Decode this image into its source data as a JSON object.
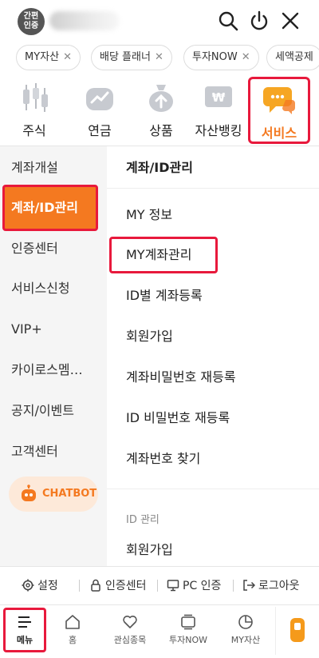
{
  "header": {
    "auth_badge": "간편\n인증",
    "icons": [
      "search-icon",
      "power-icon",
      "close-icon"
    ]
  },
  "chips": [
    {
      "label": "MY자산"
    },
    {
      "label": "배당 플래너"
    },
    {
      "label": "투자NOW"
    },
    {
      "label": "세액공제"
    }
  ],
  "categories": [
    {
      "label": "주식",
      "icon": "candlestick-icon"
    },
    {
      "label": "연금",
      "icon": "piggy-bank-icon"
    },
    {
      "label": "상품",
      "icon": "money-bag-icon"
    },
    {
      "label": "자산뱅킹",
      "icon": "won-card-icon"
    },
    {
      "label": "서비스",
      "icon": "chat-bubble-icon",
      "active": true
    }
  ],
  "sidebar": {
    "items": [
      {
        "label": "계좌개설"
      },
      {
        "label": "계좌/ID관리",
        "active": true
      },
      {
        "label": "인증센터"
      },
      {
        "label": "서비스신청"
      },
      {
        "label": "VIP+"
      },
      {
        "label": "카이로스멤…"
      },
      {
        "label": "공지/이벤트"
      },
      {
        "label": "고객센터"
      }
    ],
    "chatbot_label": "CHATBOT"
  },
  "main": {
    "heading": "계좌/ID관리",
    "items": [
      {
        "label": "MY 정보"
      },
      {
        "label": "MY계좌관리",
        "highlighted": true
      },
      {
        "label": "ID별 계좌등록"
      },
      {
        "label": "회원가입"
      },
      {
        "label": "계좌비밀번호 재등록"
      },
      {
        "label": "ID 비밀번호 재등록"
      },
      {
        "label": "계좌번호 찾기"
      }
    ],
    "section_label": "ID 관리",
    "section_items": [
      {
        "label": "회원가입"
      }
    ]
  },
  "utility": [
    {
      "label": "설정",
      "icon": "gear-icon"
    },
    {
      "label": "인증센터",
      "icon": "lock-icon"
    },
    {
      "label": "PC 인증",
      "icon": "monitor-icon"
    },
    {
      "label": "로그아웃",
      "icon": "logout-icon"
    }
  ],
  "tabs": [
    {
      "label": "메뉴",
      "icon": "menu-icon",
      "active": true
    },
    {
      "label": "홈",
      "icon": "home-icon"
    },
    {
      "label": "관심종목",
      "icon": "heart-icon"
    },
    {
      "label": "투자NOW",
      "icon": "tv-icon"
    },
    {
      "label": "MY자산",
      "icon": "pie-chart-icon"
    }
  ],
  "colors": {
    "accent": "#f47920",
    "highlight_border": "#e8193c"
  }
}
